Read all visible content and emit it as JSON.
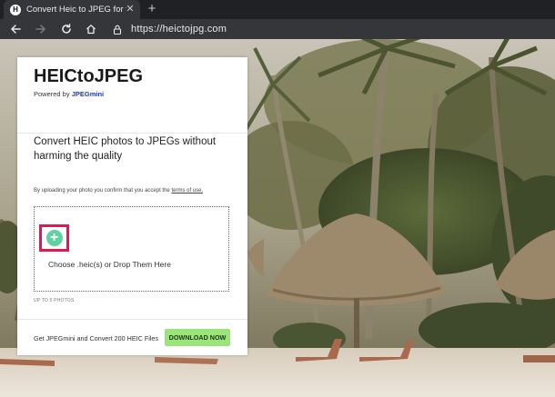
{
  "browser": {
    "tab": {
      "favicon_letter": "H",
      "title": "Convert Heic to JPEG for free | M",
      "close_label": "✕"
    },
    "new_tab_label": "+",
    "address": {
      "url": "https://heictojpg.com"
    }
  },
  "card": {
    "brand_title": "HEICtoJPEG",
    "powered_prefix": "Powered by ",
    "powered_link": "JPEGmini",
    "headline": "Convert HEIC photos to JPEGs without harming the quality",
    "consent_prefix": "By uploading your photo you confirm that you accept the ",
    "consent_link": "terms of use.",
    "add_symbol": "+",
    "drop_text": "Choose .heic(s) or Drop Them Here",
    "limit_text": "UP TO 5 PHOTOS",
    "promo_text": "Get JPEGmini and Convert 200 HEIC Files",
    "download_label": "DOWNLOAD NOW"
  },
  "colors": {
    "accent_highlight": "#e0194f",
    "add_button": "#5fd2a3",
    "download_button": "#9be37b",
    "link": "#1b3bb5"
  },
  "icons": [
    "back-arrow-icon",
    "forward-arrow-icon",
    "reload-icon",
    "home-icon",
    "lock-icon",
    "close-icon",
    "plus-icon"
  ]
}
